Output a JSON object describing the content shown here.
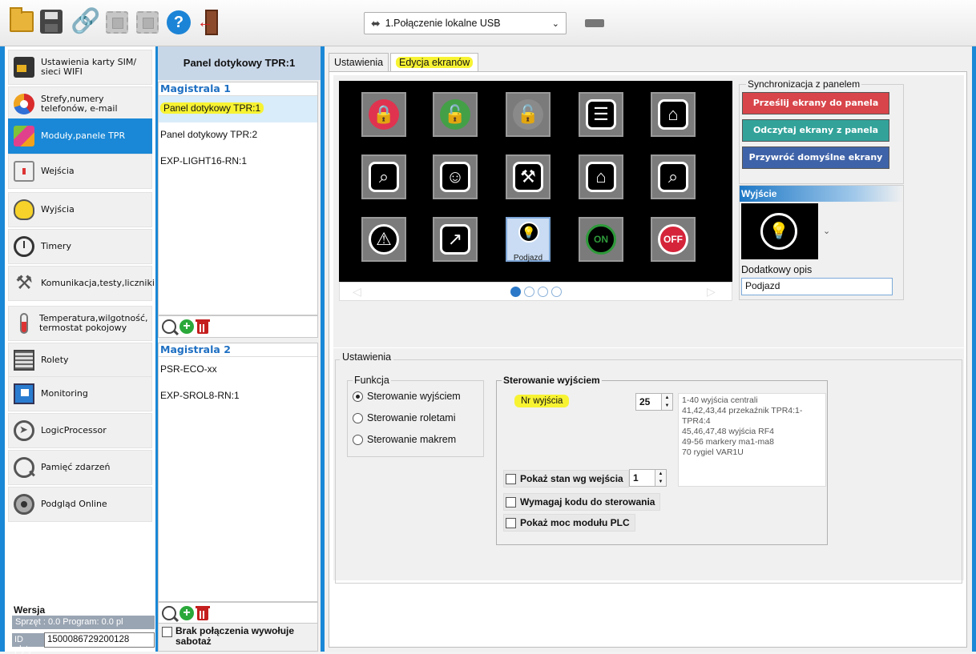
{
  "toolbar": {
    "connection_label": "1.Połączenie lokalne USB",
    "icons": [
      "folder-open-icon",
      "save-icon",
      "link-icon",
      "chip-icon",
      "chip-icon",
      "help-icon",
      "exit-icon",
      "usb-dongle-icon"
    ]
  },
  "sidebar": {
    "items": [
      {
        "label": "Ustawienia karty SIM/ sieci WIFI",
        "icon": "sim-card-icon"
      },
      {
        "label": "Strefy,numery telefonów, e-mail",
        "icon": "zones-pie-icon"
      },
      {
        "label": "Moduły,panele TPR",
        "icon": "modules-cube-icon",
        "active": true
      },
      {
        "label": "Wejścia",
        "icon": "input-icon"
      },
      {
        "label": "Wyjścia",
        "icon": "bulb-icon"
      },
      {
        "label": "Timery",
        "icon": "clock-icon"
      },
      {
        "label": "Komunikacja,testy,liczniki",
        "icon": "tools-icon"
      },
      {
        "label": "Temperatura,wilgotność, termostat pokojowy",
        "icon": "thermometer-icon"
      },
      {
        "label": "Rolety",
        "icon": "blinds-icon"
      },
      {
        "label": "Monitoring",
        "icon": "monitor-icon"
      },
      {
        "label": "LogicProcessor",
        "icon": "logic-icon"
      },
      {
        "label": "Pamięć zdarzeń",
        "icon": "event-log-icon"
      },
      {
        "label": "Podgląd Online",
        "icon": "online-preview-icon"
      }
    ],
    "version": {
      "title": "Wersja",
      "hardware": "Sprzęt : 0.0  Program: 0.0 pl",
      "id_label": "ID płyty",
      "id_value": "1500086729200128"
    }
  },
  "modules": {
    "header": "Panel dotykowy TPR:1",
    "bus1": {
      "title": "Magistrala 1",
      "items": [
        "Panel dotykowy TPR:1",
        "Panel dotykowy TPR:2",
        "EXP-LIGHT16-RN:1"
      ]
    },
    "bus2": {
      "title": "Magistrala 2",
      "items": [
        "PSR-ECO-xx",
        "EXP-SROL8-RN:1"
      ]
    },
    "sabotage_label": "Brak połączenia wywołuje sabotaż"
  },
  "tabs": [
    {
      "label": "Ustawienia"
    },
    {
      "label": "Edycja ekranów",
      "active": true
    }
  ],
  "screen_editor": {
    "tiles": [
      {
        "icon": "padlock-closed-icon",
        "color": "#e0334f",
        "label": ""
      },
      {
        "icon": "padlock-open-icon",
        "color": "#43a047",
        "label": ""
      },
      {
        "icon": "padlock-grey-icon",
        "color": "#8a8a8a",
        "label": ""
      },
      {
        "icon": "list-bulb-icon",
        "color": "#000000",
        "label": ""
      },
      {
        "icon": "house-search-icon",
        "color": "#000000",
        "label": ""
      },
      {
        "icon": "search-doc-icon",
        "color": "#000000",
        "label": ""
      },
      {
        "icon": "users-icon",
        "color": "#000000",
        "label": ""
      },
      {
        "icon": "wrench-icon",
        "color": "#000000",
        "label": ""
      },
      {
        "icon": "house-grid-icon",
        "color": "#000000",
        "label": ""
      },
      {
        "icon": "doc-search-icon",
        "color": "#000000",
        "label": ""
      },
      {
        "icon": "warning-icon",
        "color": "#000000",
        "label": ""
      },
      {
        "icon": "ai-chart-icon",
        "color": "#000000",
        "label": ""
      },
      {
        "icon": "bulb-icon",
        "color": "#000000",
        "label": "Podjazd",
        "selected": true
      },
      {
        "icon": "on-icon",
        "color": "#2e9a3a",
        "label": "ON"
      },
      {
        "icon": "off-icon",
        "color": "#d5243a",
        "label": "OFF"
      }
    ],
    "page_dots": 4,
    "active_page": 0
  },
  "sync": {
    "title": "Synchronizacja z panelem",
    "send_label": "Prześlij ekrany do panela",
    "read_label": "Odczytaj ekrany z panela",
    "restore_label": "Przywróć domyślne ekrany",
    "colors": {
      "send": "#d8454a",
      "read": "#33a39a",
      "restore": "#3f63a8"
    }
  },
  "output": {
    "title": "Wyjście",
    "desc_label": "Dodatkowy opis",
    "desc_value": "Podjazd"
  },
  "settings": {
    "title": "Ustawienia",
    "function_title": "Funkcja",
    "functions": [
      "Sterowanie wyjściem",
      "Sterowanie roletami",
      "Sterowanie makrem"
    ],
    "selected_function": 0,
    "control_title": "Sterowanie wyjściem",
    "nr_label": "Nr wyjścia",
    "nr_value": "25",
    "hints": [
      "1-40 wyjścia centrali",
      "41,42,43,44 przekaźnik TPR4:1-TPR4:4",
      "45,46,47,48 wyjścia RF4",
      "49-56 markery ma1-ma8",
      "70 rygiel VAR1U"
    ],
    "show_state_label": "Pokaż stan wg wejścia",
    "show_state_value": "1",
    "require_code_label": "Wymagaj kodu do sterowania",
    "show_power_label": "Pokaż moc modułu PLC"
  }
}
